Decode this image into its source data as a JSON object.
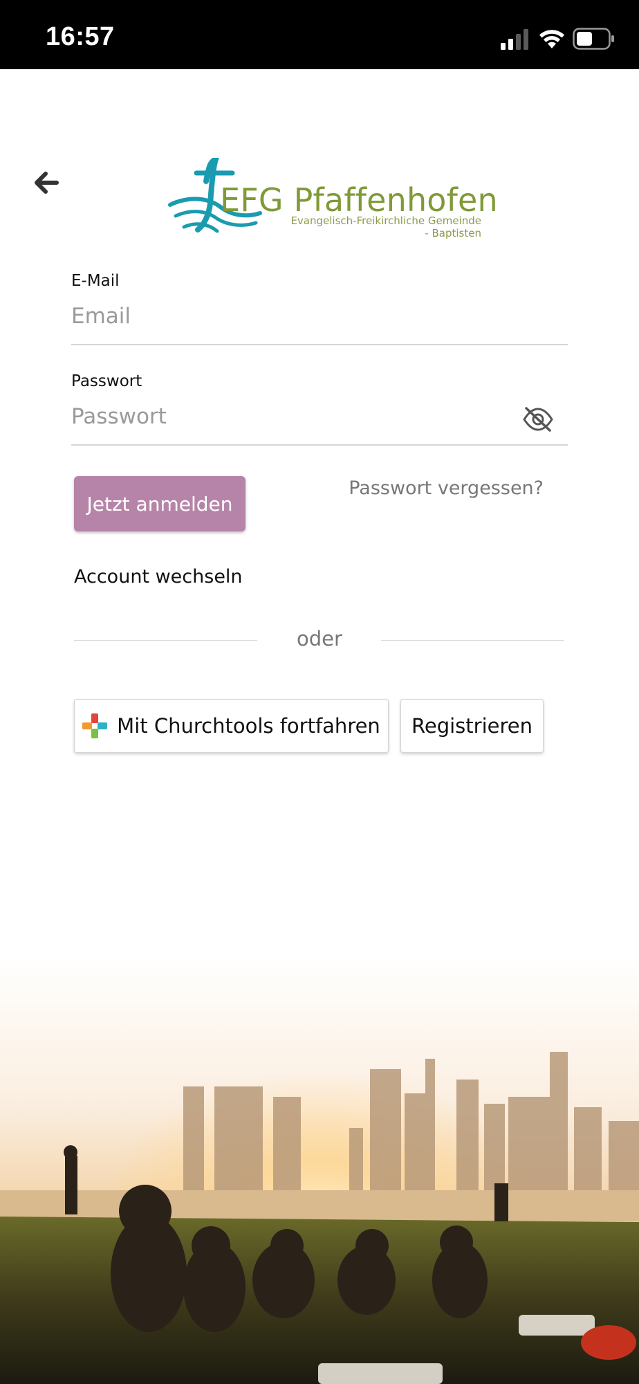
{
  "status_bar": {
    "time": "16:57",
    "icons": [
      "cellular-signal-icon",
      "wifi-icon",
      "battery-icon"
    ]
  },
  "header": {
    "back_icon": "arrow-left-icon",
    "logo": {
      "title": "EFG Pfaffenhofen",
      "subtitle_line1": "Evangelisch-Freikirchliche Gemeinde",
      "subtitle_line2": "- Baptisten"
    }
  },
  "form": {
    "email": {
      "label": "E-Mail",
      "placeholder": "Email",
      "value": ""
    },
    "password": {
      "label": "Passwort",
      "placeholder": "Passwort",
      "value": "",
      "toggle_icon": "eye-off-icon"
    },
    "login_button": "Jetzt anmelden",
    "forgot_link": "Passwort vergessen?",
    "switch_account": "Account wechseln",
    "divider": "oder",
    "churchtools_button": "Mit Churchtools fortfahren",
    "register_button": "Registrieren"
  },
  "colors": {
    "primary_button": "#b684a9",
    "logo_green": "#7f9a36",
    "logo_teal": "#1a9bb0",
    "status_bar": "#000000"
  }
}
